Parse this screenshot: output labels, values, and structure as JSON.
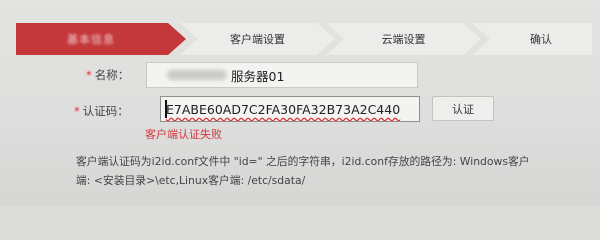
{
  "steps": [
    {
      "label": "基本信息",
      "active": true
    },
    {
      "label": "客户端设置",
      "active": false
    },
    {
      "label": "云端设置",
      "active": false
    },
    {
      "label": "确认",
      "active": false
    }
  ],
  "form": {
    "name_label": "名称：",
    "name_value": "服务器01",
    "code_label": "认证码：",
    "code_value": "E7ABE60AD7C2FA30FA32B73A2C440",
    "verify_label": "认证",
    "error_text": "客户端认证失败",
    "required_mark": "*"
  },
  "help": {
    "line1": "客户端认证码为i2id.conf文件中 \"id=\" 之后的字符串，i2id.conf存放的路径为: Windows客户",
    "line2": "端: <安装目录>\\etc,Linux客户端: /etc/sdata/"
  },
  "colors": {
    "accent": "#c4373b",
    "error": "#cf3a3f"
  }
}
